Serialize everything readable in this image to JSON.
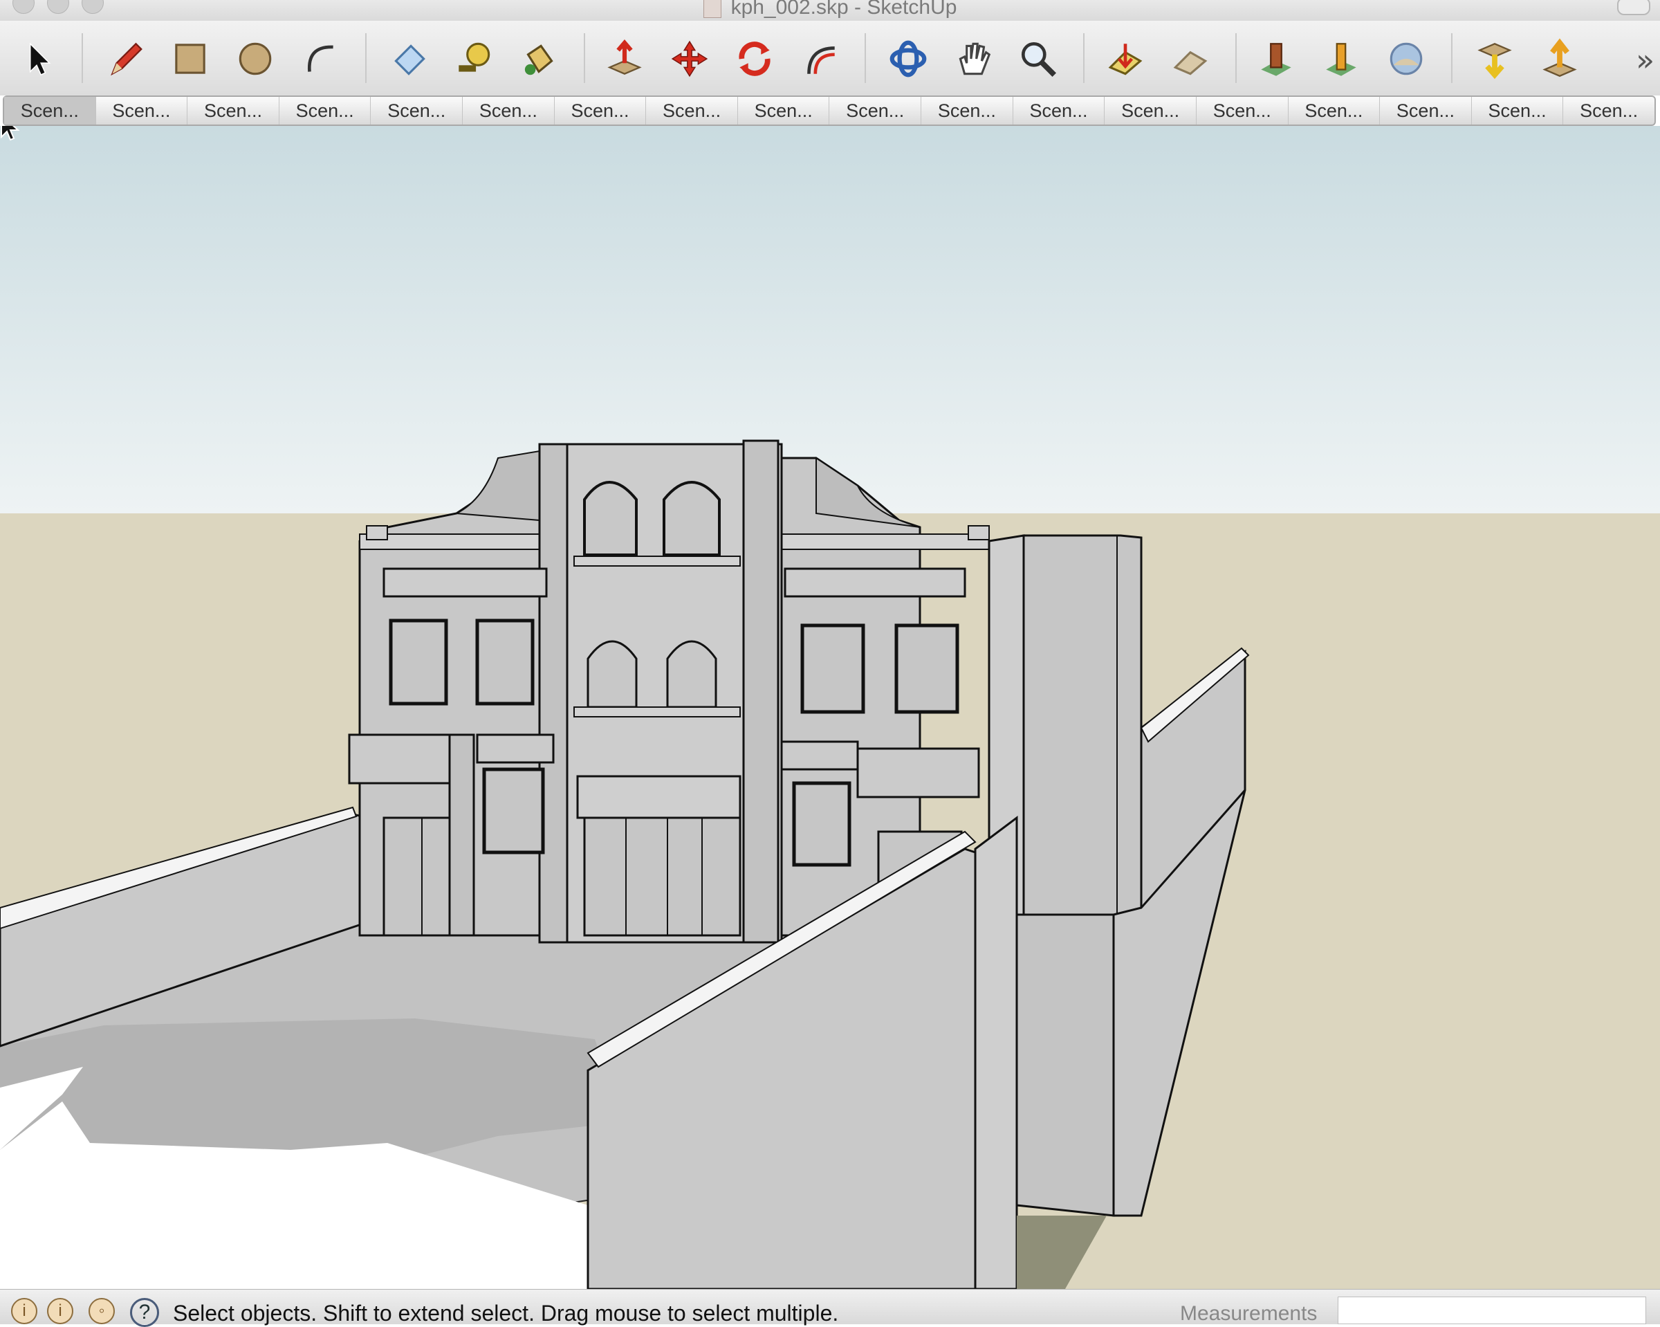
{
  "window": {
    "title": "kph_002.skp - SketchUp"
  },
  "toolbar": {
    "tools": [
      {
        "name": "select-tool",
        "icon": "arrow-cursor-icon"
      },
      {
        "name": "pencil-tool",
        "icon": "pencil-icon"
      },
      {
        "name": "rectangle-tool",
        "icon": "rectangle-icon"
      },
      {
        "name": "circle-tool",
        "icon": "circle-icon"
      },
      {
        "name": "arc-tool",
        "icon": "arc-icon"
      },
      {
        "name": "eraser-tool",
        "icon": "eraser-icon"
      },
      {
        "name": "tape-measure-tool",
        "icon": "tape-measure-icon"
      },
      {
        "name": "paint-bucket-tool",
        "icon": "paint-bucket-icon"
      },
      {
        "name": "push-pull-tool",
        "icon": "push-pull-icon"
      },
      {
        "name": "move-tool",
        "icon": "move-icon"
      },
      {
        "name": "rotate-tool",
        "icon": "rotate-icon"
      },
      {
        "name": "offset-tool",
        "icon": "offset-icon"
      },
      {
        "name": "orbit-tool",
        "icon": "orbit-icon"
      },
      {
        "name": "pan-tool",
        "icon": "hand-icon"
      },
      {
        "name": "zoom-tool",
        "icon": "magnifier-icon"
      },
      {
        "name": "zoom-extents-tool",
        "icon": "zoom-extents-icon"
      },
      {
        "name": "previous-view-tool",
        "icon": "previous-view-icon"
      },
      {
        "name": "position-camera-tool",
        "icon": "position-camera-icon"
      },
      {
        "name": "walk-tool",
        "icon": "walk-icon"
      },
      {
        "name": "look-around-tool",
        "icon": "look-around-icon"
      },
      {
        "name": "get-models-tool",
        "icon": "get-models-icon"
      },
      {
        "name": "share-model-tool",
        "icon": "share-model-icon"
      }
    ],
    "overflow_label": "»"
  },
  "scenes": {
    "tabs": [
      "Scen...",
      "Scen...",
      "Scen...",
      "Scen...",
      "Scen...",
      "Scen...",
      "Scen...",
      "Scen...",
      "Scen...",
      "Scen...",
      "Scen...",
      "Scen...",
      "Scen...",
      "Scen...",
      "Scen...",
      "Scen...",
      "Scen...",
      "Scen..."
    ],
    "active_index": 0
  },
  "colors": {
    "sky_top": "#c9dbe0",
    "sky_bottom": "#eef3f4",
    "ground": "#dcd6bf",
    "building": "#c8c8c8",
    "shadow": "#b3b3b3"
  },
  "status": {
    "message": "Select objects. Shift to extend select. Drag mouse to select multiple.",
    "measurements_label": "Measurements",
    "measurements_value": ""
  }
}
